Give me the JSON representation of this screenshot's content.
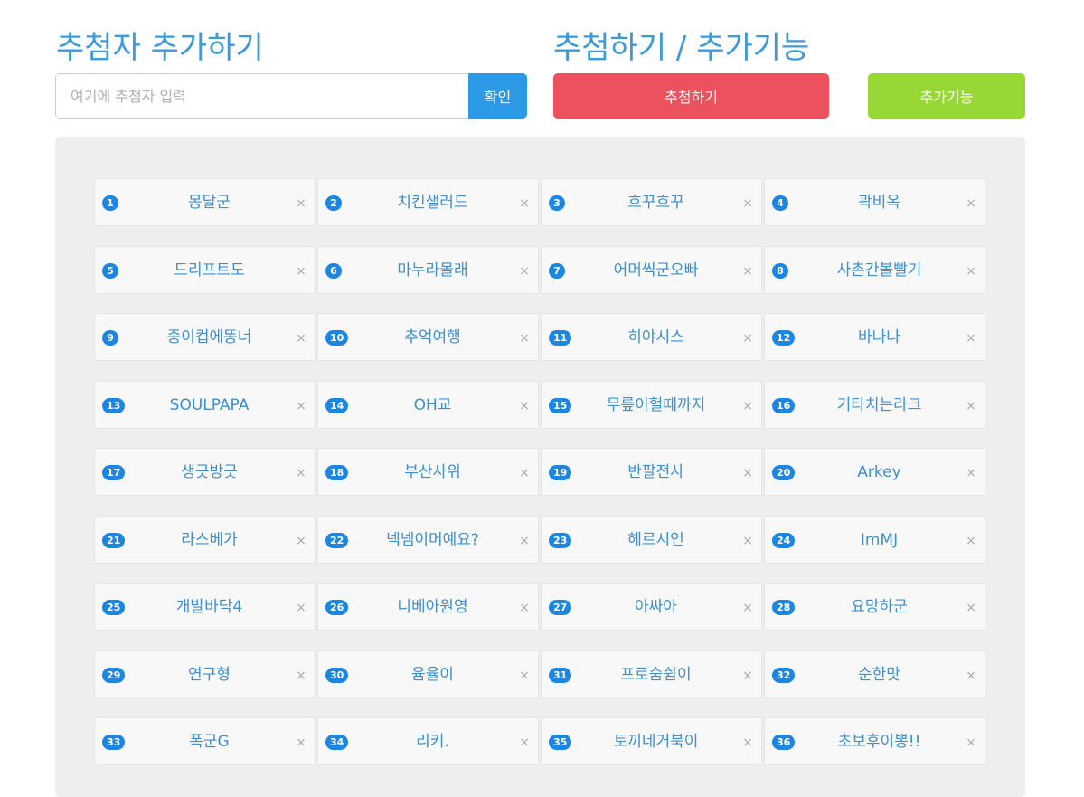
{
  "add_section": {
    "title": "추첨자 추가하기",
    "input_placeholder": "여기에 추첨자 입력",
    "input_value": "",
    "confirm_label": "확인"
  },
  "draw_section": {
    "title": "추첨하기 / 추가기능",
    "draw_label": "추첨하기",
    "extra_label": "추가기능"
  },
  "remove_glyph": "×",
  "colors": {
    "heading": "#3d9ad6",
    "confirm_button": "#2d9ae8",
    "draw_button": "#ec525e",
    "extra_button": "#97d836",
    "badge": "#1c86e3",
    "name_text": "#3d8fcf"
  },
  "icons": {
    "remove": "close-icon"
  },
  "participants": [
    {
      "num": "1",
      "name": "몽달군"
    },
    {
      "num": "2",
      "name": "치킨샐러드"
    },
    {
      "num": "3",
      "name": "흐꾸흐꾸"
    },
    {
      "num": "4",
      "name": "곽비옥"
    },
    {
      "num": "5",
      "name": "드리프트도"
    },
    {
      "num": "6",
      "name": "마누라몰래"
    },
    {
      "num": "7",
      "name": "어머씩군오빠"
    },
    {
      "num": "8",
      "name": "사촌간볼빨기"
    },
    {
      "num": "9",
      "name": "종이컵에똥너"
    },
    {
      "num": "10",
      "name": "추억여행"
    },
    {
      "num": "11",
      "name": "히야시스"
    },
    {
      "num": "12",
      "name": "바나나"
    },
    {
      "num": "13",
      "name": "SOULPAPA"
    },
    {
      "num": "14",
      "name": "OH교"
    },
    {
      "num": "15",
      "name": "무릎이헐때까지"
    },
    {
      "num": "16",
      "name": "기타치는라크"
    },
    {
      "num": "17",
      "name": "생긋방긋"
    },
    {
      "num": "18",
      "name": "부산사위"
    },
    {
      "num": "19",
      "name": "반팔전사"
    },
    {
      "num": "20",
      "name": "Arkey"
    },
    {
      "num": "21",
      "name": "라스베가"
    },
    {
      "num": "22",
      "name": "넥넴이머예요?"
    },
    {
      "num": "23",
      "name": "헤르시언"
    },
    {
      "num": "24",
      "name": "ImMJ"
    },
    {
      "num": "25",
      "name": "개발바닥4"
    },
    {
      "num": "26",
      "name": "니베아원영"
    },
    {
      "num": "27",
      "name": "아싸아"
    },
    {
      "num": "28",
      "name": "요망하군"
    },
    {
      "num": "29",
      "name": "연구형"
    },
    {
      "num": "30",
      "name": "윰율이"
    },
    {
      "num": "31",
      "name": "프로숨쉼이"
    },
    {
      "num": "32",
      "name": "순한맛"
    },
    {
      "num": "33",
      "name": "폭군G"
    },
    {
      "num": "34",
      "name": "리키."
    },
    {
      "num": "35",
      "name": "토끼네거북이"
    },
    {
      "num": "36",
      "name": "초보후이뽕!!"
    }
  ]
}
